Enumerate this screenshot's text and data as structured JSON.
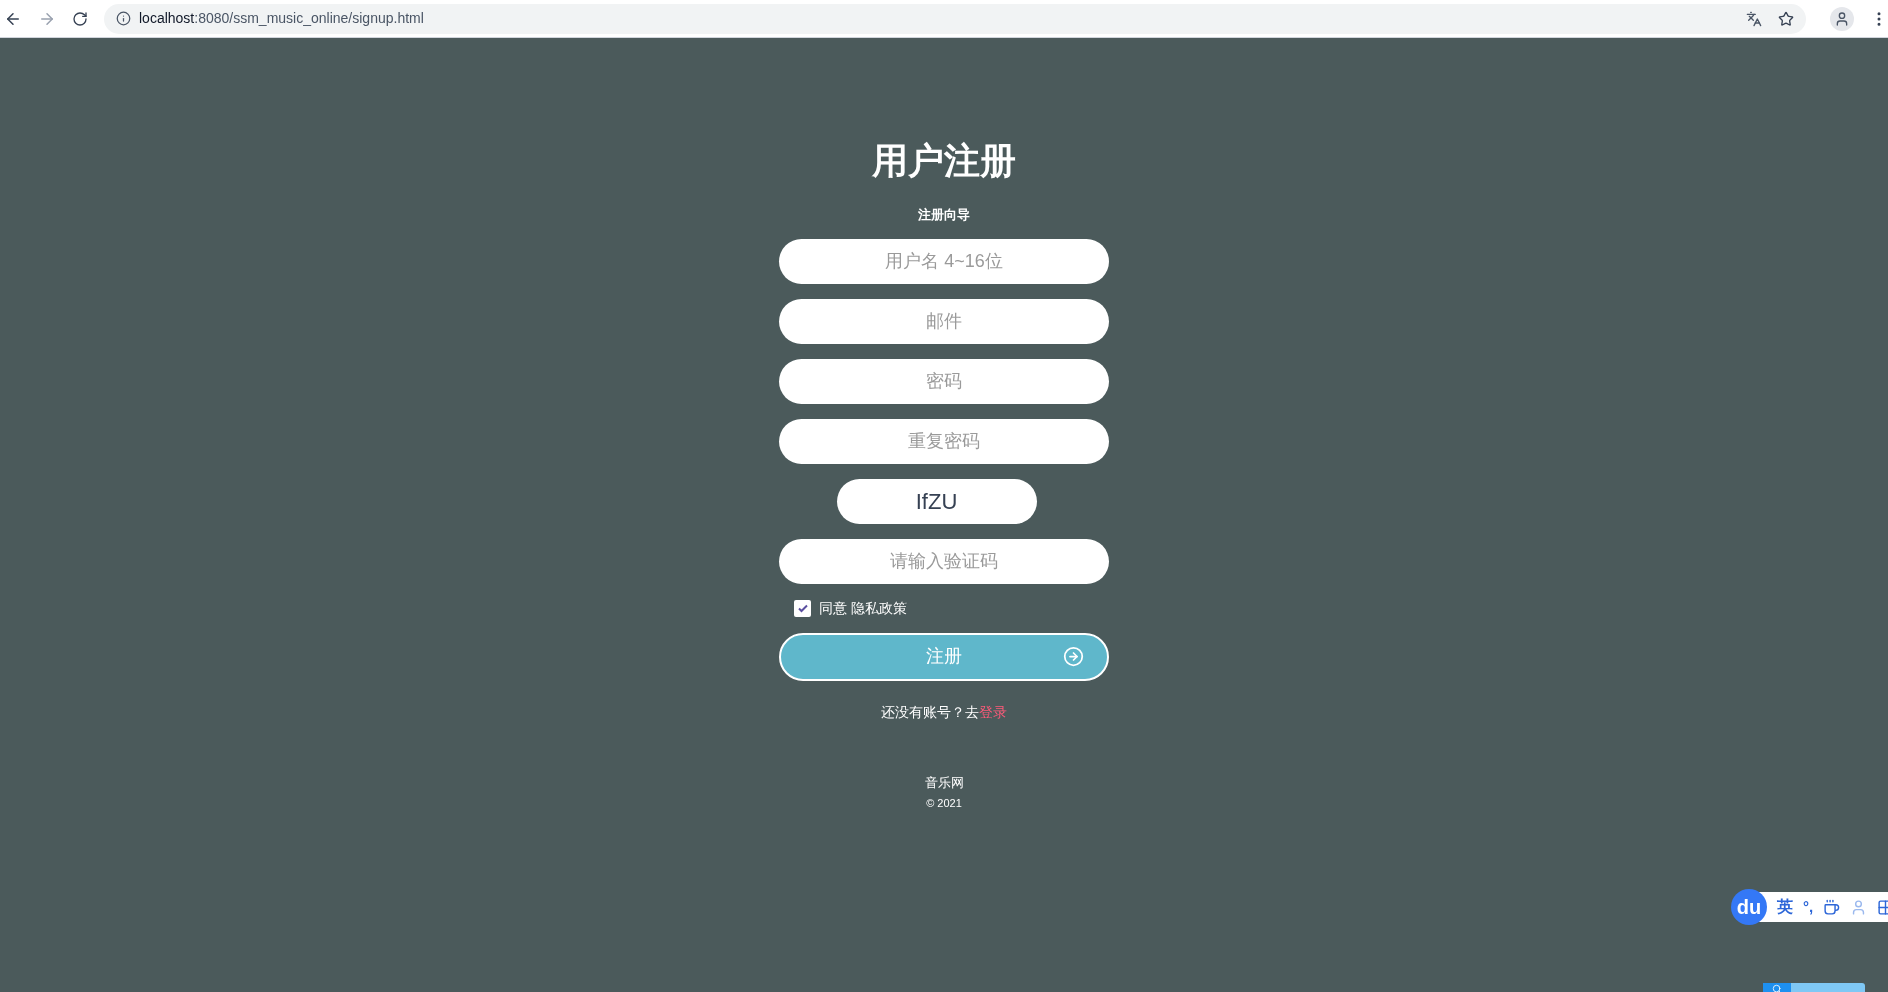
{
  "browser": {
    "url_host": "localhost",
    "url_rest": ":8080/ssm_music_online/signup.html"
  },
  "form": {
    "title": "用户注册",
    "subtitle": "注册向导",
    "fields": [
      {
        "placeholder": "用户名 4~16位"
      },
      {
        "placeholder": "邮件"
      },
      {
        "placeholder": "密码"
      },
      {
        "placeholder": "重复密码"
      }
    ],
    "captcha": "IfZU",
    "captcha_field": {
      "placeholder": "请输入验证码"
    },
    "agree": {
      "label": "同意 隐私政策",
      "checked": true
    },
    "submit": "注册",
    "prompt": "还没有账号？去",
    "login_link": "登录"
  },
  "footer": {
    "site": "音乐网",
    "copyright": "© 2021"
  },
  "ime": {
    "logo": "du",
    "mode": "英",
    "punct": "°,"
  }
}
